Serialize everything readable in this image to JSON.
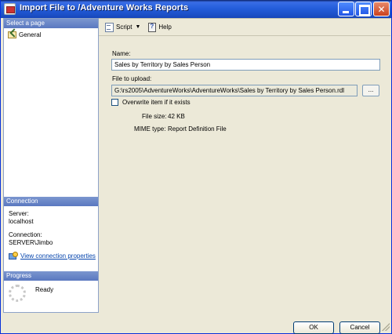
{
  "window": {
    "title": "Import File to /Adventure Works Reports"
  },
  "left": {
    "select_page_header": "Select a page",
    "pages": [
      {
        "label": "General",
        "icon": "properties-icon"
      }
    ],
    "connection_header": "Connection",
    "server_label": "Server:",
    "server_value": "localhost",
    "connection_label": "Connection:",
    "connection_value": "SERVER\\Jimbo",
    "view_connection_link": "View connection properties",
    "progress_header": "Progress",
    "progress_status": "Ready"
  },
  "toolbar": {
    "script_label": "Script",
    "help_label": "Help"
  },
  "form": {
    "name_label": "Name:",
    "name_value": "Sales by Territory by Sales Person",
    "file_label": "File to upload:",
    "file_value": "G:\\rs2005\\AdventureWorks\\AdventureWorks\\Sales by Territory by Sales Person.rdl",
    "browse_label": "...",
    "overwrite_label": "Overwrite item if it exists",
    "overwrite_checked": false,
    "file_size_label": "File size:",
    "file_size_value": "42 KB",
    "mime_label": "MIME type:",
    "mime_value": "Report Definition File"
  },
  "buttons": {
    "ok": "OK",
    "cancel": "Cancel"
  },
  "colors": {
    "title_bar": "#245edb",
    "section_header": "#6a86c8",
    "link": "#0645ad",
    "dialog_bg": "#ece9d8"
  }
}
